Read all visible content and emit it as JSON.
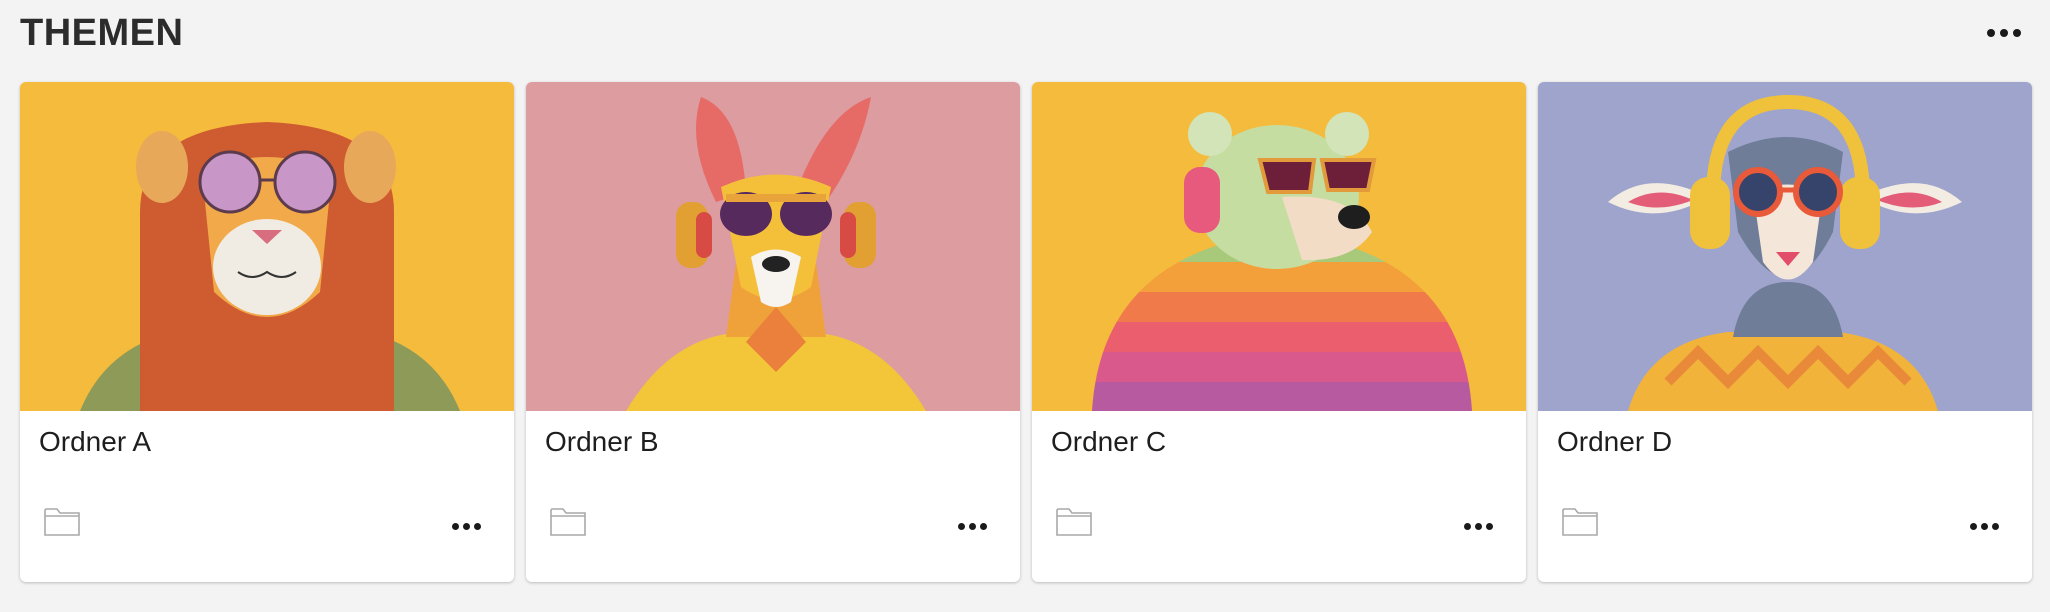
{
  "section": {
    "title": "THEMEN"
  },
  "cards": [
    {
      "title": "Ordner A",
      "bg": "#f4bb3c",
      "animal": "lion",
      "image_label": "lion-with-pink-glasses"
    },
    {
      "title": "Ordner B",
      "bg": "#dd9ca0",
      "animal": "kangaroo",
      "image_label": "kangaroo-with-headphones"
    },
    {
      "title": "Ordner C",
      "bg": "#f4bb3c",
      "animal": "polar-bear",
      "image_label": "bear-with-headphones"
    },
    {
      "title": "Ordner D",
      "bg": "#9ea4cc",
      "animal": "sheep",
      "image_label": "sheep-with-headphones"
    }
  ],
  "icons": {
    "folder": "folder-icon",
    "more": "more-options-icon"
  }
}
